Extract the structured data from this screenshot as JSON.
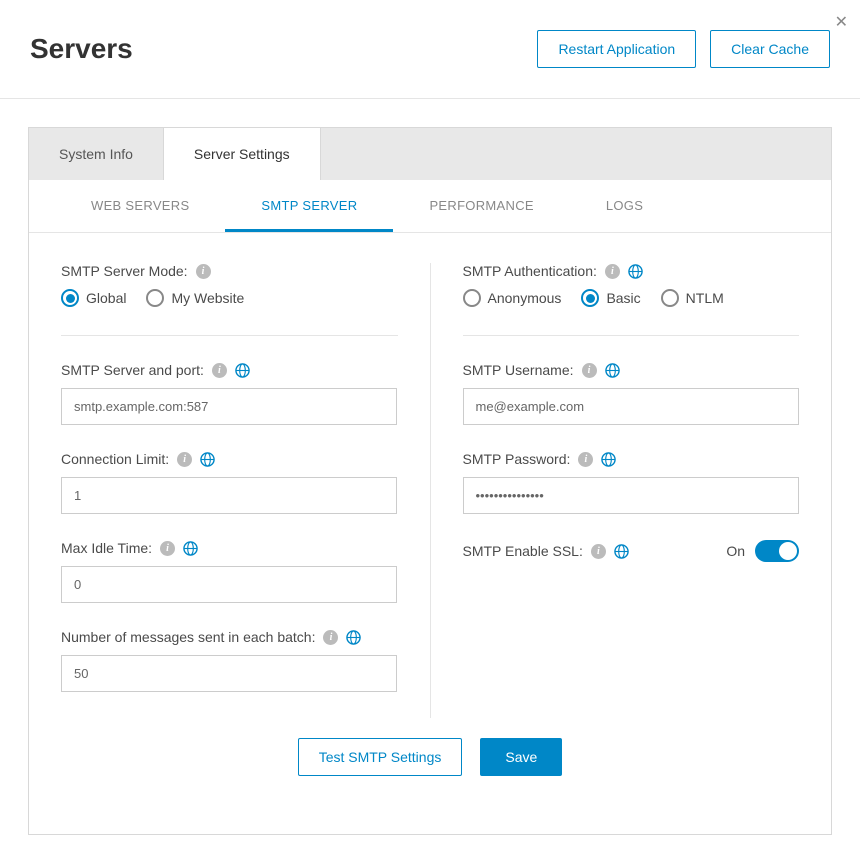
{
  "header": {
    "title": "Servers",
    "restart_label": "Restart Application",
    "clear_cache_label": "Clear Cache"
  },
  "tabs": {
    "system_info": "System Info",
    "server_settings": "Server Settings"
  },
  "subtabs": {
    "web_servers": "WEB SERVERS",
    "smtp_server": "SMTP SERVER",
    "performance": "PERFORMANCE",
    "logs": "LOGS"
  },
  "left": {
    "mode_label": "SMTP Server Mode:",
    "mode_global": "Global",
    "mode_mywebsite": "My Website",
    "server_port_label": "SMTP Server and port:",
    "server_port_value": "smtp.example.com:587",
    "conn_limit_label": "Connection Limit:",
    "conn_limit_value": "1",
    "max_idle_label": "Max Idle Time:",
    "max_idle_value": "0",
    "batch_label": "Number of messages sent in each batch:",
    "batch_value": "50"
  },
  "right": {
    "auth_label": "SMTP Authentication:",
    "auth_anon": "Anonymous",
    "auth_basic": "Basic",
    "auth_ntlm": "NTLM",
    "username_label": "SMTP Username:",
    "username_value": "me@example.com",
    "password_label": "SMTP Password:",
    "password_value": "•••••••••••••••",
    "ssl_label": "SMTP Enable SSL:",
    "ssl_state": "On"
  },
  "actions": {
    "test_label": "Test SMTP Settings",
    "save_label": "Save"
  }
}
